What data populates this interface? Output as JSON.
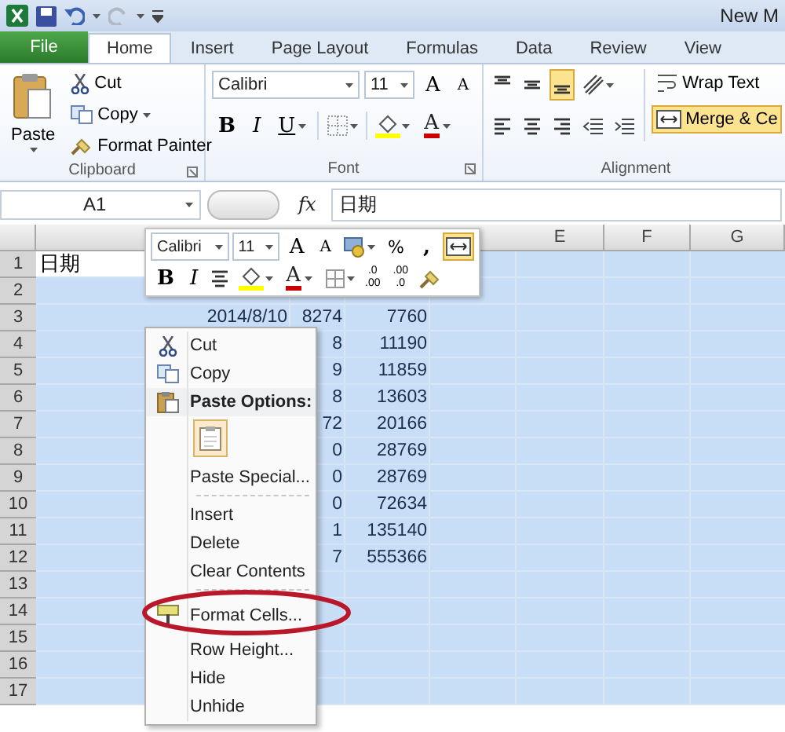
{
  "title_bar": {
    "title": "New M"
  },
  "tabs": [
    {
      "label": "File",
      "kind": "file",
      "selected": false
    },
    {
      "label": "Home",
      "kind": "tab",
      "selected": true
    },
    {
      "label": "Insert",
      "kind": "tab",
      "selected": false
    },
    {
      "label": "Page Layout",
      "kind": "tab",
      "selected": false
    },
    {
      "label": "Formulas",
      "kind": "tab",
      "selected": false
    },
    {
      "label": "Data",
      "kind": "tab",
      "selected": false
    },
    {
      "label": "Review",
      "kind": "tab",
      "selected": false
    },
    {
      "label": "View",
      "kind": "tab",
      "selected": false
    }
  ],
  "clipboard": {
    "paste": "Paste",
    "cut": "Cut",
    "copy": "Copy",
    "format_painter": "Format Painter",
    "label": "Clipboard"
  },
  "font": {
    "name": "Calibri",
    "size": "11",
    "grow": "A",
    "shrink": "A",
    "bold": "B",
    "italic": "I",
    "underline": "U",
    "font_color": "A",
    "label": "Font"
  },
  "alignment": {
    "vertical": [
      {
        "selected": false
      },
      {
        "selected": false
      },
      {
        "selected": true
      }
    ],
    "horizontal": [
      {
        "selected": false
      },
      {
        "selected": false
      },
      {
        "selected": false
      }
    ],
    "wrap_text": {
      "label": "Wrap Text",
      "selected": false
    },
    "merge": {
      "label": "Merge & Ce",
      "selected": true
    },
    "label": "Alignment"
  },
  "formula_bar": {
    "name_box": "A1",
    "fx": "fx",
    "value": "日期"
  },
  "column_headers": [
    "E",
    "F",
    "G"
  ],
  "rows": [
    {
      "number": "1",
      "column_a": "日期"
    },
    {
      "number": "2"
    },
    {
      "number": "3",
      "column_a": "2014/8/10",
      "column_b": "8274",
      "column_c": "7760"
    },
    {
      "number": "4",
      "column_b": "8",
      "column_c": "11190"
    },
    {
      "number": "5",
      "column_b": "9",
      "column_c": "11859"
    },
    {
      "number": "6",
      "column_b": "8",
      "column_c": "13603"
    },
    {
      "number": "7",
      "column_b": "72",
      "column_c": "20166"
    },
    {
      "number": "8",
      "column_b": "0",
      "column_c": "28769"
    },
    {
      "number": "9",
      "column_b": "0",
      "column_c": "28769"
    },
    {
      "number": "10",
      "column_b": "0",
      "column_c": "72634"
    },
    {
      "number": "11",
      "column_b": "1",
      "column_c": "135140"
    },
    {
      "number": "12",
      "column_b": "7",
      "column_c": "555366"
    },
    {
      "number": "13"
    },
    {
      "number": "14"
    },
    {
      "number": "15"
    },
    {
      "number": "16"
    },
    {
      "number": "17"
    }
  ],
  "mini_toolbar": {
    "font": "Calibri",
    "size": "11",
    "grow": "A",
    "shrink": "A",
    "percent": "%",
    "comma": ",",
    "merge_selected": true,
    "bold": "B",
    "italic": "I",
    "font_color": "A",
    "increase_decimal": [
      ".0",
      ".00"
    ],
    "decrease_decimal": [
      ".00",
      ".0"
    ]
  },
  "context_menu": [
    {
      "kind": "cut",
      "label": "Cut"
    },
    {
      "kind": "copy",
      "label": "Copy"
    },
    {
      "kind": "header",
      "label": "Paste Options:"
    },
    {
      "kind": "paste_options"
    },
    {
      "kind": "item",
      "label": "Paste Special..."
    },
    {
      "kind": "separator"
    },
    {
      "kind": "item",
      "label": "Insert"
    },
    {
      "kind": "item",
      "label": "Delete"
    },
    {
      "kind": "item",
      "label": "Clear Contents"
    },
    {
      "kind": "separator"
    },
    {
      "kind": "format",
      "label": "Format Cells..."
    },
    {
      "kind": "item",
      "label": "Row Height..."
    },
    {
      "kind": "item",
      "label": "Hide"
    },
    {
      "kind": "item",
      "label": "Unhide"
    }
  ]
}
